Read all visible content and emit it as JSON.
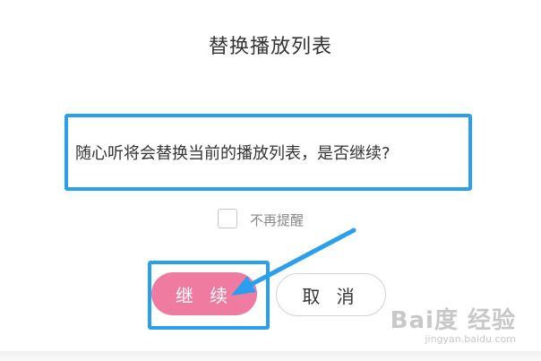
{
  "dialog": {
    "title": "替换播放列表",
    "message": "随心听将会替换当前的播放列表，是否继续?",
    "checkbox_label": "不再提醒",
    "checkbox_checked": false,
    "buttons": {
      "continue_label": "继 续",
      "cancel_label": "取 消"
    }
  },
  "watermark": {
    "logo": "Bai度 经验",
    "url": "jingyan.baidu.com"
  },
  "colors": {
    "accent_pink": "#f07ba0",
    "annotation_blue": "#2a9ff0",
    "text_dark": "#333333",
    "text_gray": "#888888"
  }
}
